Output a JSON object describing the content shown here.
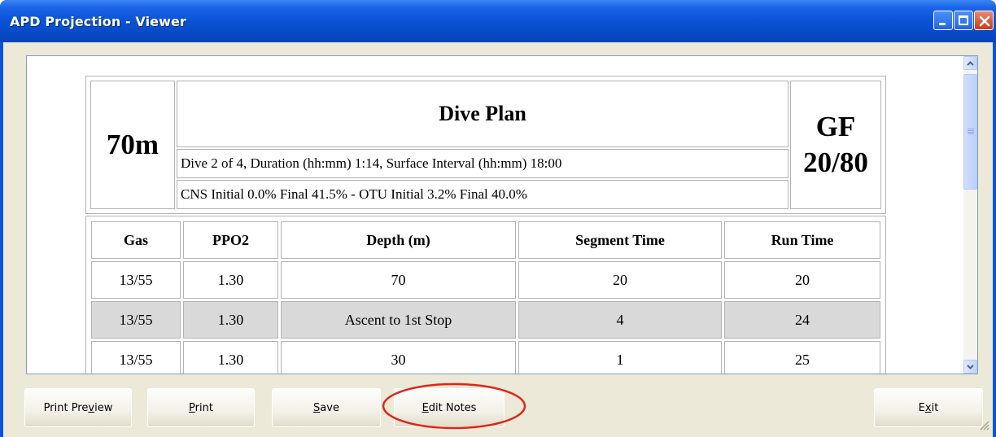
{
  "window": {
    "title": "APD Projection - Viewer",
    "controls": [
      "minimize-icon",
      "maximize-icon",
      "close-icon"
    ]
  },
  "plan": {
    "depth": "70m",
    "title": "Dive Plan",
    "gf_label": "GF",
    "gf_value": "20/80",
    "dive_info": "Dive 2 of 4, Duration (hh:mm) 1:14, Surface Interval (hh:mm) 18:00",
    "cns_info": "CNS Initial 0.0% Final 41.5% - OTU Initial 3.2% Final 40.0%"
  },
  "table": {
    "headers": [
      "Gas",
      "PPO2",
      "Depth (m)",
      "Segment Time",
      "Run Time"
    ],
    "rows": [
      [
        "13/55",
        "1.30",
        "70",
        "20",
        "20"
      ],
      [
        "13/55",
        "1.30",
        "Ascent to 1st Stop",
        "4",
        "24"
      ],
      [
        "13/55",
        "1.30",
        "30",
        "1",
        "25"
      ]
    ]
  },
  "buttons": {
    "print_preview": {
      "pre": "Print Pre",
      "ul": "v",
      "post": "iew"
    },
    "print": {
      "pre": "",
      "ul": "P",
      "post": "rint"
    },
    "save": {
      "pre": "",
      "ul": "S",
      "post": "ave"
    },
    "edit_notes": {
      "pre": "",
      "ul": "E",
      "post": "dit Notes"
    },
    "exit": {
      "pre": "E",
      "ul": "x",
      "post": "it"
    }
  },
  "colors": {
    "titlebar": "#0a52d6",
    "shaded_row": "#d9d9d9",
    "highlight_oval": "#e0251b"
  }
}
